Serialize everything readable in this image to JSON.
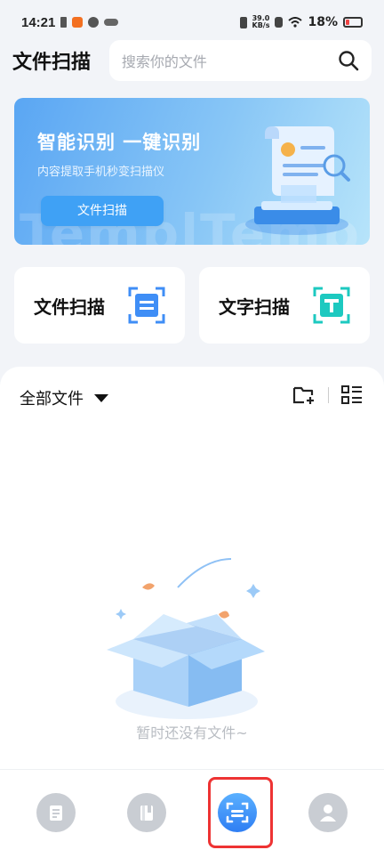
{
  "status_bar": {
    "time": "14:21",
    "speed_value": "39.0",
    "speed_unit": "KB/s",
    "battery": "18%"
  },
  "header": {
    "title": "文件扫描",
    "search_placeholder": "搜索你的文件"
  },
  "banner": {
    "title": "智能识别 一键识别",
    "subtitle": "内容提取手机秒变扫描仪",
    "button": "文件扫描",
    "watermark": "TemplTemp"
  },
  "cards": [
    {
      "label": "文件扫描",
      "icon": "document-scan-icon",
      "color": "#3f8ef6"
    },
    {
      "label": "文字扫描",
      "icon": "text-scan-icon",
      "color": "#1dc9c0"
    }
  ],
  "files": {
    "filter_label": "全部文件",
    "empty_text": "暂时还没有文件~"
  },
  "nav": {
    "items": [
      {
        "icon": "documents-icon",
        "active": false
      },
      {
        "icon": "book-icon",
        "active": false
      },
      {
        "icon": "scan-icon",
        "active": true
      },
      {
        "icon": "profile-icon",
        "active": false
      }
    ],
    "active_color": "#3f8ef6",
    "highlight_color": "#e33333"
  }
}
